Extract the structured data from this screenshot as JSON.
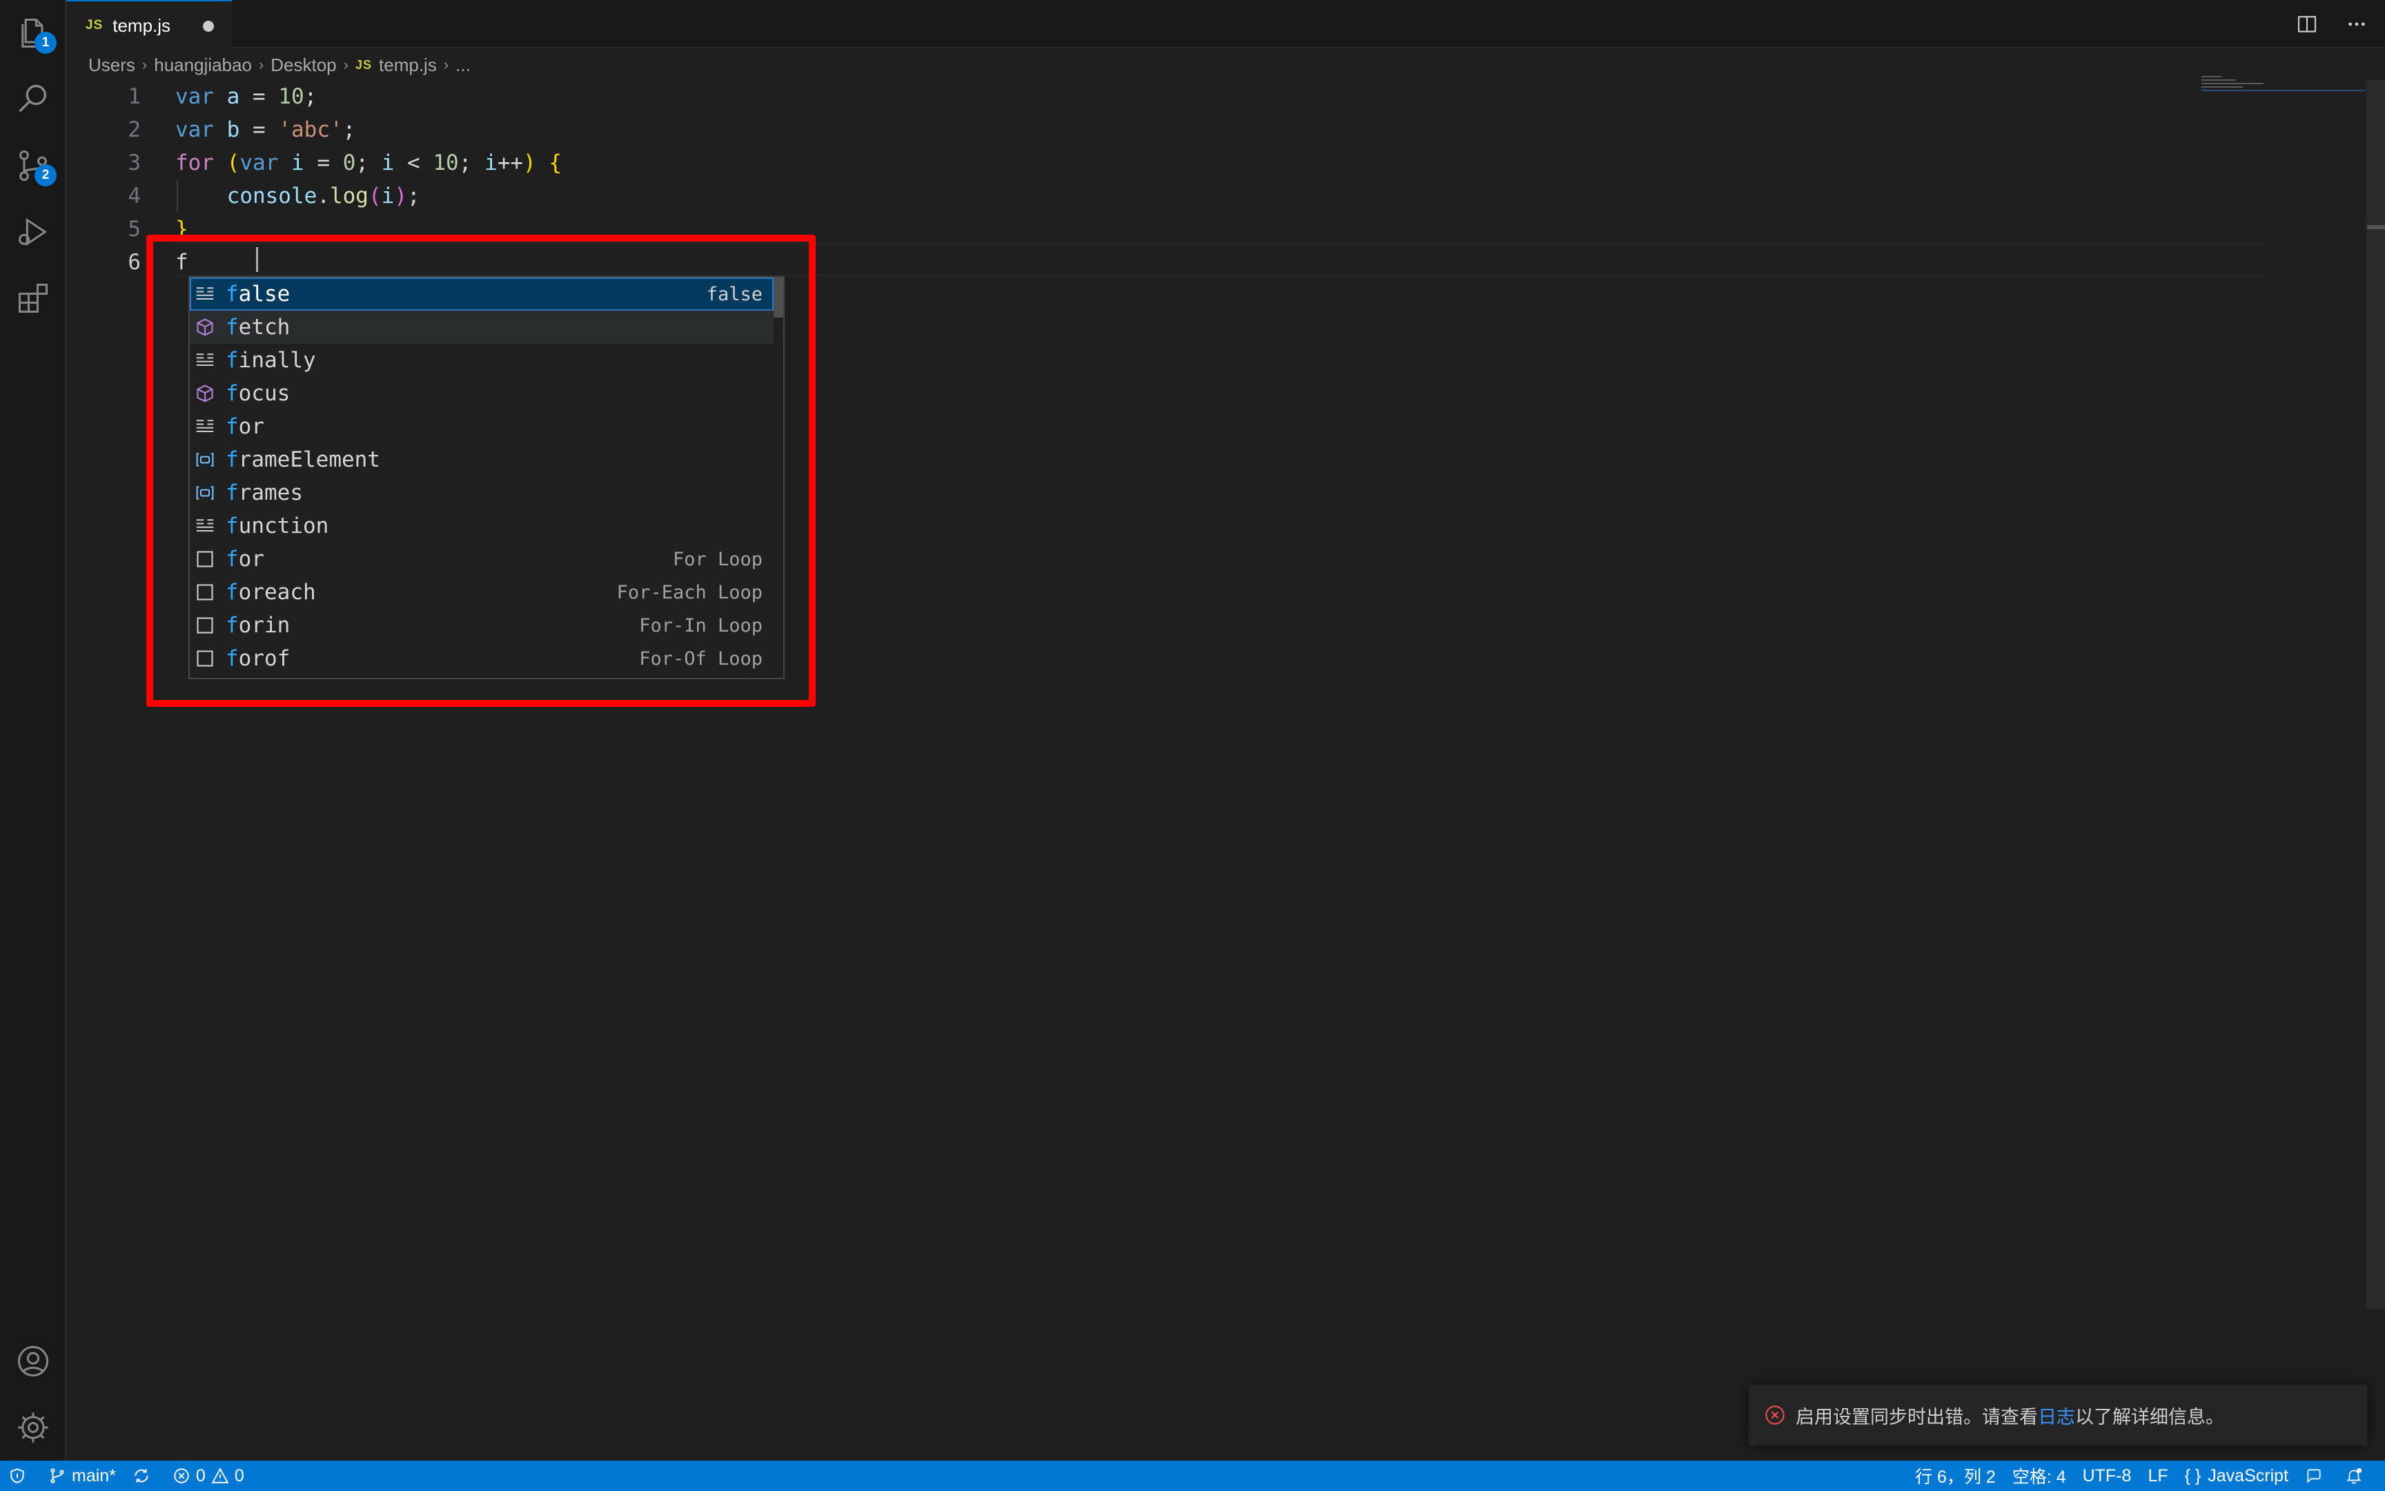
{
  "tab": {
    "filename": "temp.js",
    "file_type": "JS",
    "dirty": true
  },
  "breadcrumb": {
    "items": [
      "Users",
      "huangjiabao",
      "Desktop",
      "temp.js",
      "..."
    ],
    "file_type": "JS"
  },
  "activity_bar": {
    "items": [
      {
        "name": "explorer-icon",
        "badge": "1"
      },
      {
        "name": "search-icon"
      },
      {
        "name": "source-control-icon",
        "badge": "2"
      },
      {
        "name": "run-debug-icon"
      },
      {
        "name": "extensions-icon"
      }
    ],
    "bottom": [
      "account-icon",
      "settings-gear-icon"
    ]
  },
  "editor": {
    "line_numbers": [
      "1",
      "2",
      "3",
      "4",
      "5",
      "6"
    ],
    "active_line": 6,
    "current_input": "f"
  },
  "suggest": {
    "items": [
      {
        "label": "false",
        "detail": "false",
        "icon": "keyword-icon",
        "selected": true
      },
      {
        "label": "fetch",
        "detail": "",
        "icon": "method-icon"
      },
      {
        "label": "finally",
        "detail": "",
        "icon": "keyword-icon"
      },
      {
        "label": "focus",
        "detail": "",
        "icon": "method-icon"
      },
      {
        "label": "for",
        "detail": "",
        "icon": "keyword-icon"
      },
      {
        "label": "frameElement",
        "detail": "",
        "icon": "variable-icon"
      },
      {
        "label": "frames",
        "detail": "",
        "icon": "variable-icon"
      },
      {
        "label": "function",
        "detail": "",
        "icon": "keyword-icon"
      },
      {
        "label": "for",
        "detail": "For Loop",
        "icon": "snippet-icon"
      },
      {
        "label": "foreach",
        "detail": "For-Each Loop",
        "icon": "snippet-icon"
      },
      {
        "label": "forin",
        "detail": "For-In Loop",
        "icon": "snippet-icon"
      },
      {
        "label": "forof",
        "detail": "For-Of Loop",
        "icon": "snippet-icon"
      }
    ]
  },
  "notification": {
    "text_before": "启用设置同步时出错。请查看",
    "link": "日志",
    "text_after": "以了解详细信息。"
  },
  "status_bar": {
    "branch": "main*",
    "errors": "0",
    "warnings": "0",
    "position": "行 6，列 2",
    "spaces": "空格: 4",
    "encoding": "UTF-8",
    "eol": "LF",
    "language": "JavaScript",
    "language_prefix": "{ }"
  },
  "colors": {
    "accent": "#0078d4",
    "highlight_box": "#ff0000",
    "selection": "#04395e"
  }
}
